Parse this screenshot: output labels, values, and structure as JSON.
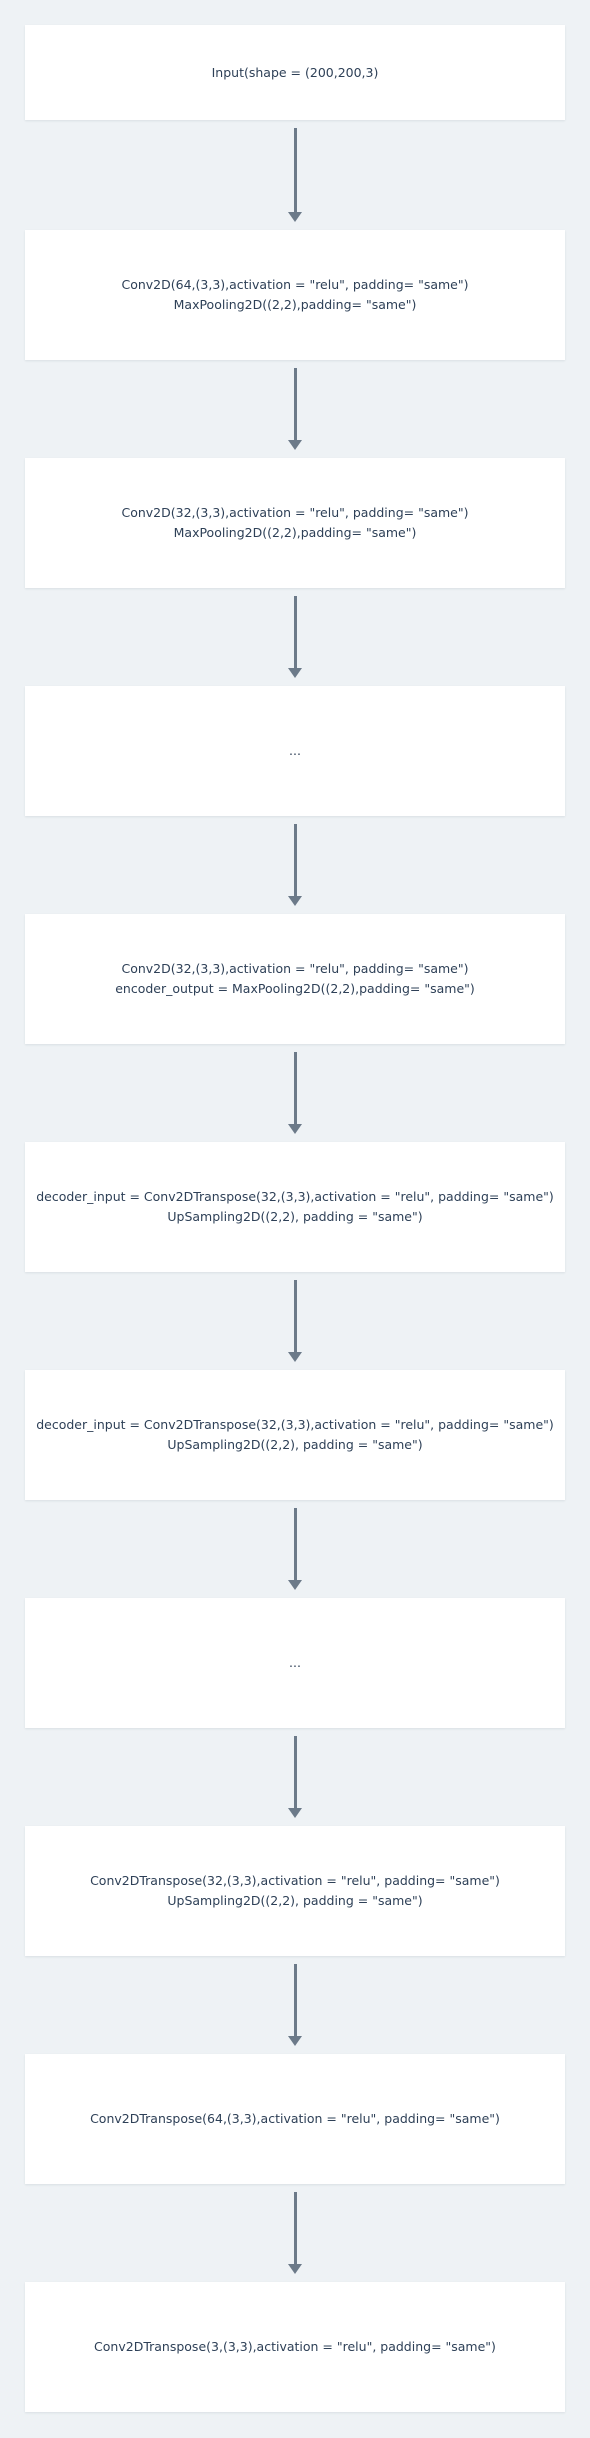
{
  "nodes": [
    {
      "lines": [
        "Input(shape = (200,200,3)"
      ]
    },
    {
      "lines": [
        "Conv2D(64,(3,3),activation = \"relu\", padding= \"same\")",
        "MaxPooling2D((2,2),padding= \"same\")"
      ]
    },
    {
      "lines": [
        "Conv2D(32,(3,3),activation = \"relu\", padding= \"same\")",
        "MaxPooling2D((2,2),padding= \"same\")"
      ]
    },
    {
      "lines": [
        "..."
      ]
    },
    {
      "lines": [
        "Conv2D(32,(3,3),activation = \"relu\", padding= \"same\")",
        "encoder_output = MaxPooling2D((2,2),padding= \"same\")"
      ]
    },
    {
      "lines": [
        "decoder_input = Conv2DTranspose(32,(3,3),activation = \"relu\", padding= \"same\")",
        "UpSampling2D((2,2), padding = \"same\")"
      ]
    },
    {
      "lines": [
        "decoder_input = Conv2DTranspose(32,(3,3),activation = \"relu\", padding= \"same\")",
        "UpSampling2D((2,2), padding = \"same\")"
      ]
    },
    {
      "lines": [
        "..."
      ]
    },
    {
      "lines": [
        "Conv2DTranspose(32,(3,3),activation = \"relu\", padding= \"same\")",
        "UpSampling2D((2,2), padding = \"same\")"
      ]
    },
    {
      "lines": [
        "Conv2DTranspose(64,(3,3),activation = \"relu\", padding= \"same\")"
      ]
    },
    {
      "lines": [
        "Conv2DTranspose(3,(3,3),activation = \"relu\", padding= \"same\")"
      ]
    }
  ],
  "colors": {
    "background": "#eef2f5",
    "node_fill": "#ffffff",
    "text": "#2e4057",
    "arrow": "#6c7a89"
  }
}
